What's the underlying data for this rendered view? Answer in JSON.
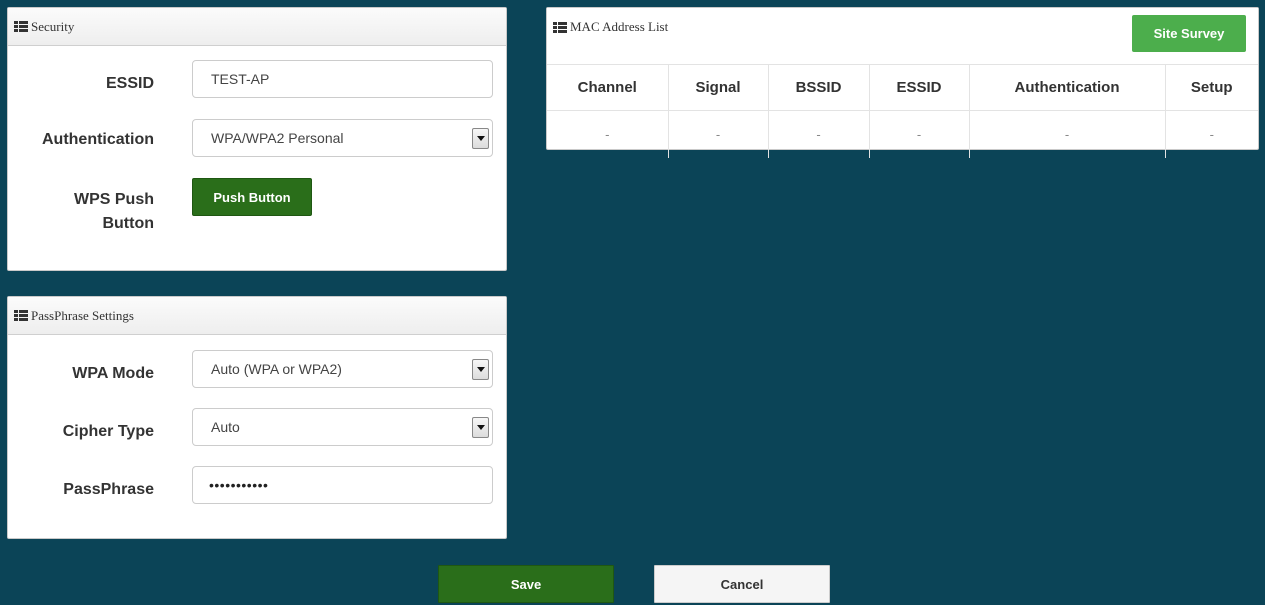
{
  "security": {
    "title": "Security",
    "essid_label": "ESSID",
    "essid_value": "TEST-AP",
    "auth_label": "Authentication",
    "auth_value": "WPA/WPA2 Personal",
    "wps_label_line1": "WPS Push",
    "wps_label_line2": "Button",
    "wps_button": "Push Button"
  },
  "passphrase": {
    "title": "PassPhrase Settings",
    "wpa_mode_label": "WPA Mode",
    "wpa_mode_value": "Auto (WPA or WPA2)",
    "cipher_label": "Cipher Type",
    "cipher_value": "Auto",
    "passphrase_label": "PassPhrase",
    "passphrase_value": "•••••••••••"
  },
  "mac_list": {
    "title": "MAC Address List",
    "site_survey": "Site Survey",
    "columns": [
      "Channel",
      "Signal",
      "BSSID",
      "ESSID",
      "Authentication",
      "Setup"
    ],
    "row": [
      "-",
      "-",
      "-",
      "-",
      "-",
      "-"
    ]
  },
  "actions": {
    "save": "Save",
    "cancel": "Cancel"
  },
  "colors": {
    "background": "#0b4457",
    "primary_green": "#2a6e1a",
    "site_survey_green": "#4cae4c"
  },
  "icons": {
    "panel_header": "th-list-icon",
    "select": "chevron-down-icon"
  }
}
